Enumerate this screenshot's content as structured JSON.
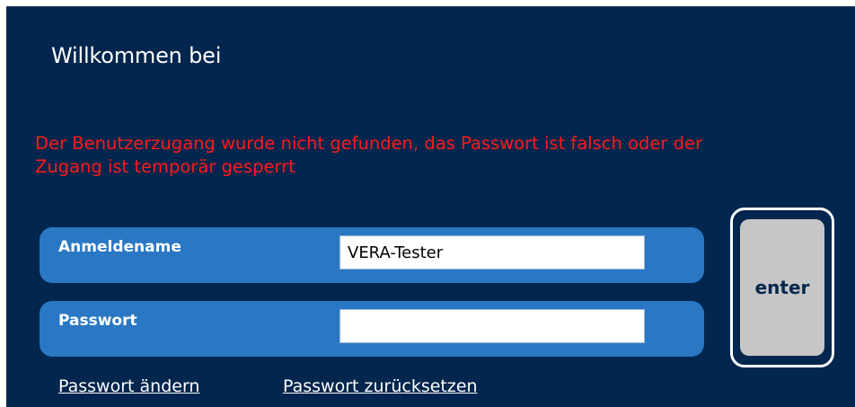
{
  "welcome": {
    "title": "Willkommen bei"
  },
  "error": {
    "message": "Der Benutzerzugang wurde nicht gefunden, das Passwort ist falsch oder der Zugang ist temporär gesperrt"
  },
  "form": {
    "username_label": "Anmeldename",
    "username_value": "VERA-Tester",
    "password_label": "Passwort",
    "password_value": ""
  },
  "buttons": {
    "enter_label": "enter"
  },
  "links": {
    "change_password": "Passwort ändern",
    "reset_password": "Passwort zurücksetzen"
  },
  "colors": {
    "background": "#02264d",
    "field_row": "#2a78c4",
    "error": "#ff1a1a",
    "button": "#c6c6c6"
  }
}
